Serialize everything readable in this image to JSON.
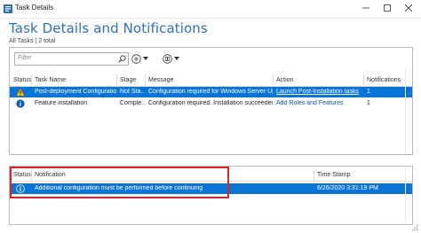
{
  "window": {
    "title": "Task Details"
  },
  "header": {
    "title": "Task Details and Notifications",
    "subtitle": "All Tasks | 2 total"
  },
  "filter": {
    "placeholder": "Filter"
  },
  "tasks": {
    "columns": [
      "Status",
      "Task Name",
      "Stage",
      "Message",
      "Action",
      "Notifications"
    ],
    "rows": [
      {
        "status_icon": "warning-icon",
        "name": "Post-deployment Configuration",
        "stage": "Not Sta...",
        "message": "Configuration required for Windows Server Up...",
        "action": "Launch Post-Installation tasks",
        "notifications": "1",
        "selected": true
      },
      {
        "status_icon": "info-icon",
        "name": "Feature installation",
        "stage": "Comple...",
        "message": "Configuration required. Installation succeeded...",
        "action": "Add Roles and Features",
        "notifications": "1",
        "selected": false
      }
    ]
  },
  "notifications": {
    "columns": [
      "Status",
      "Notification",
      "Time Stamp"
    ],
    "rows": [
      {
        "status_icon": "info-icon",
        "text": "Additional configuration must be performed before continuing",
        "timestamp": "6/26/2020 3:31:19 PM",
        "selected": true
      }
    ]
  },
  "colors": {
    "accent": "#2a72b8",
    "selection": "#0b74d7",
    "highlight_box": "#d9242a"
  }
}
